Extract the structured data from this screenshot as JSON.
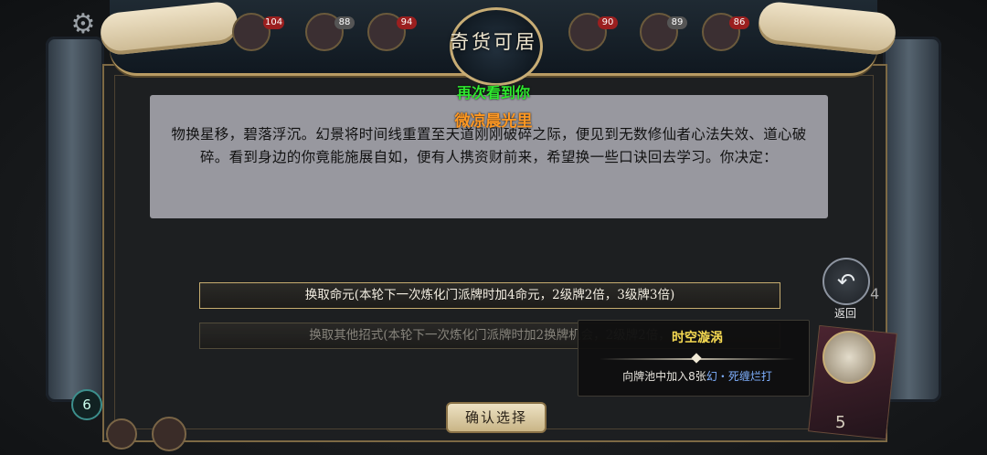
{
  "header": {
    "title": "奇货可居",
    "scores": [
      "104",
      "88",
      "94",
      "90",
      "89",
      "86"
    ]
  },
  "greeting": {
    "line1": "再次看到你",
    "player_name": "微凉晨光里"
  },
  "dialog": {
    "text": "物换星移，碧落浮沉。幻景将时间线重置至天道刚刚破碎之际，便见到无数修仙者心法失效、道心破碎。看到身边的你竟能施展自如，便有人携资财前来，希望换一些口诀回去学习。你决定："
  },
  "options": [
    {
      "label": "换取命元(本轮下一次炼化门派牌时加4命元，2级牌2倍，3级牌3倍)"
    },
    {
      "label": "换取其他招式(本轮下一次炼化门派牌时加2换牌机会，2级牌2倍，"
    }
  ],
  "tooltip": {
    "title": "时空漩涡",
    "desc_prefix": "向牌池中加入8张",
    "desc_highlight": "幻・死缠烂打"
  },
  "buttons": {
    "confirm": "确认选择",
    "back": "返回"
  },
  "sidebar": {
    "back_count": "4",
    "deck_count": "5",
    "left_badge": "6"
  },
  "colors": {
    "greeting": "#2ee82e",
    "player_name": "#ff9822",
    "tooltip_title": "#f6da52",
    "tooltip_highlight": "#7fb0ff"
  }
}
